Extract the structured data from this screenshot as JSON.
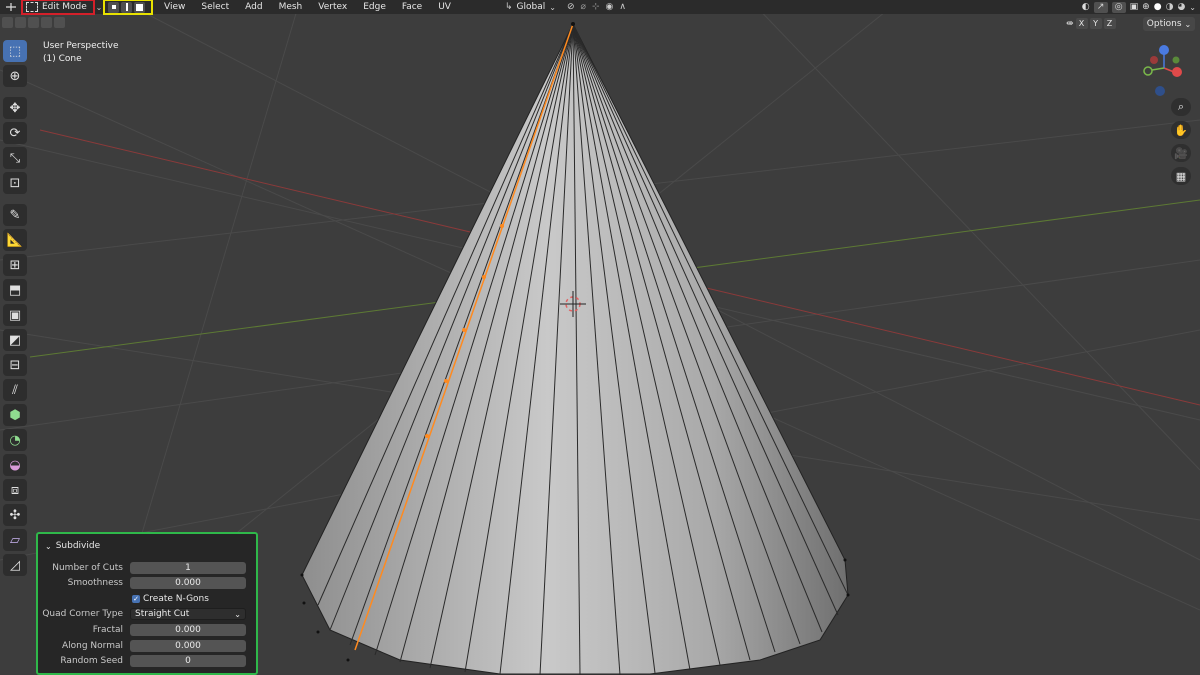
{
  "header": {
    "mode": "Edit Mode",
    "menus": [
      "View",
      "Select",
      "Add",
      "Mesh",
      "Vertex",
      "Edge",
      "Face",
      "UV"
    ],
    "transform_orientation": "Global",
    "axes": [
      "X",
      "Y",
      "Z"
    ],
    "options_label": "Options"
  },
  "viewport": {
    "perspective": "User Perspective",
    "object": "(1) Cone"
  },
  "operator_panel": {
    "title": "Subdivide",
    "fields": {
      "number_of_cuts": {
        "label": "Number of Cuts",
        "value": "1"
      },
      "smoothness": {
        "label": "Smoothness",
        "value": "0.000"
      },
      "create_ngons": {
        "label": "Create N-Gons",
        "checked": true
      },
      "quad_corner_type": {
        "label": "Quad Corner Type",
        "value": "Straight Cut"
      },
      "fractal": {
        "label": "Fractal",
        "value": "0.000"
      },
      "along_normal": {
        "label": "Along Normal",
        "value": "0.000"
      },
      "random_seed": {
        "label": "Random Seed",
        "value": "0"
      }
    }
  },
  "colors": {
    "highlight_mode": "#d4202a",
    "highlight_select_mode": "#e8e200",
    "highlight_panel": "#2fb84a",
    "selected_edge": "#ff8a1f",
    "accent": "#4772b3"
  },
  "icons": {
    "toolbar": [
      "select-box-icon",
      "cursor-icon",
      "move-icon",
      "rotate-icon",
      "scale-icon",
      "transform-icon",
      "annotate-icon",
      "measure-icon",
      "add-cube-icon",
      "extrude-icon",
      "inset-icon",
      "bevel-icon",
      "loop-cut-icon",
      "knife-icon",
      "poly-build-icon",
      "spin-icon",
      "smooth-icon",
      "edge-slide-icon",
      "shrink-fatten-icon",
      "shear-icon",
      "rip-icon"
    ]
  }
}
